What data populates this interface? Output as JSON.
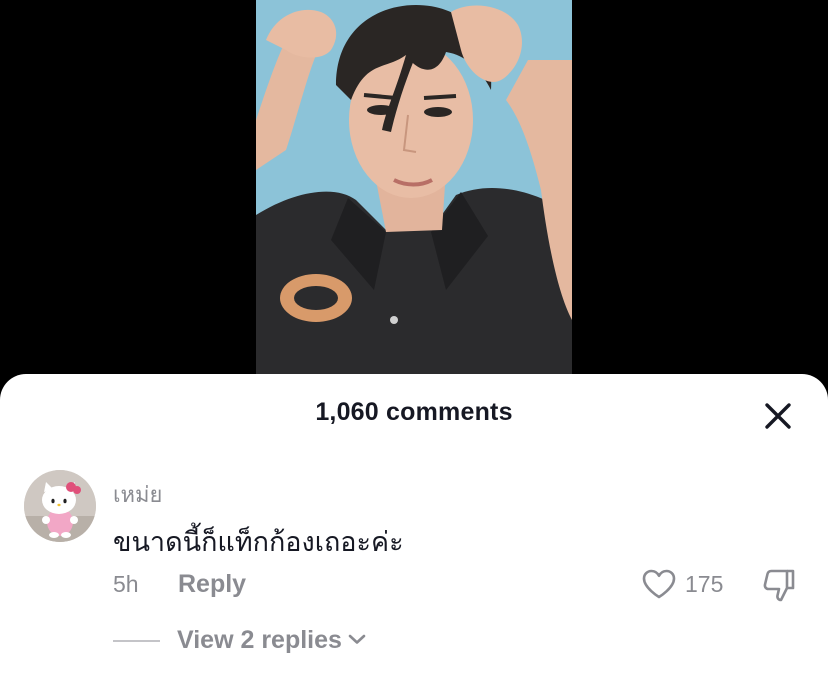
{
  "video": {
    "subject": "man with hands in hair, dark shirt, light blue background"
  },
  "comments_sheet": {
    "title": "1,060 comments",
    "close_icon": "close-icon"
  },
  "comment": {
    "avatar_icon": "hello-kitty-avatar",
    "username": "เหม่ย",
    "text": "ขนาดนี้ก็แท็กก้องเถอะค่ะ",
    "time": "5h",
    "reply_label": "Reply",
    "likes": "175",
    "view_replies_label": "View 2 replies"
  },
  "colors": {
    "text_primary": "#161823",
    "text_secondary": "#8a8b91",
    "background": "#ffffff",
    "video_bg": "#000000"
  }
}
